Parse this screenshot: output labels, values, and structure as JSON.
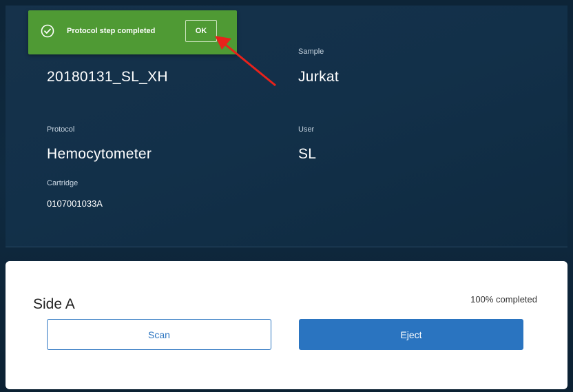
{
  "toast": {
    "message": "Protocol step completed",
    "ok_label": "OK",
    "icon": "check-circle-icon",
    "color": "#4f9a34"
  },
  "info": {
    "experiment_value": "20180131_SL_XH",
    "sample_label": "Sample",
    "sample_value": "Jurkat",
    "protocol_label": "Protocol",
    "protocol_value": "Hemocytometer",
    "user_label": "User",
    "user_value": "SL",
    "cartridge_label": "Cartridge",
    "cartridge_value": "0107001033A"
  },
  "side": {
    "title": "Side A",
    "progress_text": "100% completed",
    "progress_percent": 100,
    "scan_label": "Scan",
    "eject_label": "Eject",
    "accent": "#2a74c0"
  },
  "annotation": {
    "arrow_color": "#e8221b"
  }
}
